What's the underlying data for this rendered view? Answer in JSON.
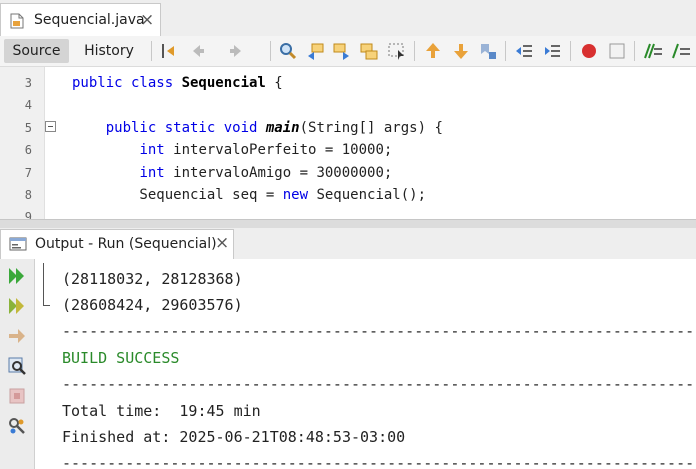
{
  "editor_tab": {
    "filename": "Sequencial.java",
    "close_glyph": "×"
  },
  "toolbar": {
    "source_label": "Source",
    "history_label": "History",
    "icons": [
      "last-edit-icon",
      "back-icon",
      "forward-icon",
      "find-icon",
      "find-previous-icon",
      "find-next-icon",
      "toggle-highlight-icon",
      "find-selection-icon",
      "previous-bookmark-icon",
      "next-bookmark-icon",
      "toggle-bookmark-icon",
      "shift-left-icon",
      "shift-right-icon",
      "record-macro-icon",
      "stop-macro-icon",
      "comment-icon",
      "uncomment-icon"
    ]
  },
  "editor": {
    "lines": [
      {
        "n": "3",
        "tokens": [
          [
            "kw",
            "public class "
          ],
          [
            "cls",
            "Sequencial"
          ],
          [
            "p",
            " {"
          ]
        ]
      },
      {
        "n": "4",
        "tokens": []
      },
      {
        "n": "5",
        "tokens": [
          [
            "p",
            "    "
          ],
          [
            "kw",
            "public static void "
          ],
          [
            "mth",
            "main"
          ],
          [
            "p",
            "(String[] args) {"
          ]
        ]
      },
      {
        "n": "6",
        "tokens": [
          [
            "p",
            "        "
          ],
          [
            "kw",
            "int "
          ],
          [
            "p",
            "intervaloPerfeito = 10000;"
          ]
        ]
      },
      {
        "n": "7",
        "tokens": [
          [
            "p",
            "        "
          ],
          [
            "kw",
            "int "
          ],
          [
            "p",
            "intervaloAmigo = 30000000;"
          ]
        ]
      },
      {
        "n": "8",
        "tokens": [
          [
            "p",
            "        Sequencial seq = "
          ],
          [
            "kw",
            "new "
          ],
          [
            "p",
            "Sequencial();"
          ]
        ]
      },
      {
        "n": "9",
        "tokens": []
      }
    ]
  },
  "output_tab": {
    "title": "Output - Run (Sequencial)",
    "close_glyph": "×"
  },
  "output_side": [
    "rerun-icon",
    "rerun-with-options-icon",
    "stop-arrow-icon",
    "inspect-icon",
    "stop-icon",
    "settings-icon"
  ],
  "output": {
    "lines": [
      {
        "text": "(28118032, 28128368)",
        "style": "normal"
      },
      {
        "text": "(28608424, 29603576)",
        "style": "normal"
      },
      {
        "text": "------------------------------------------------------------------------",
        "style": "normal"
      },
      {
        "text": "BUILD SUCCESS",
        "style": "green"
      },
      {
        "text": "------------------------------------------------------------------------",
        "style": "normal"
      },
      {
        "text": "Total time:  19:45 min",
        "style": "normal"
      },
      {
        "text": "Finished at: 2025-06-21T08:48:53-03:00",
        "style": "normal"
      },
      {
        "text": "------------------------------------------------------------------------",
        "style": "normal"
      }
    ]
  },
  "colors": {
    "keyword": "#0000e6",
    "success": "#2a8a2a",
    "record": "#d83030"
  }
}
